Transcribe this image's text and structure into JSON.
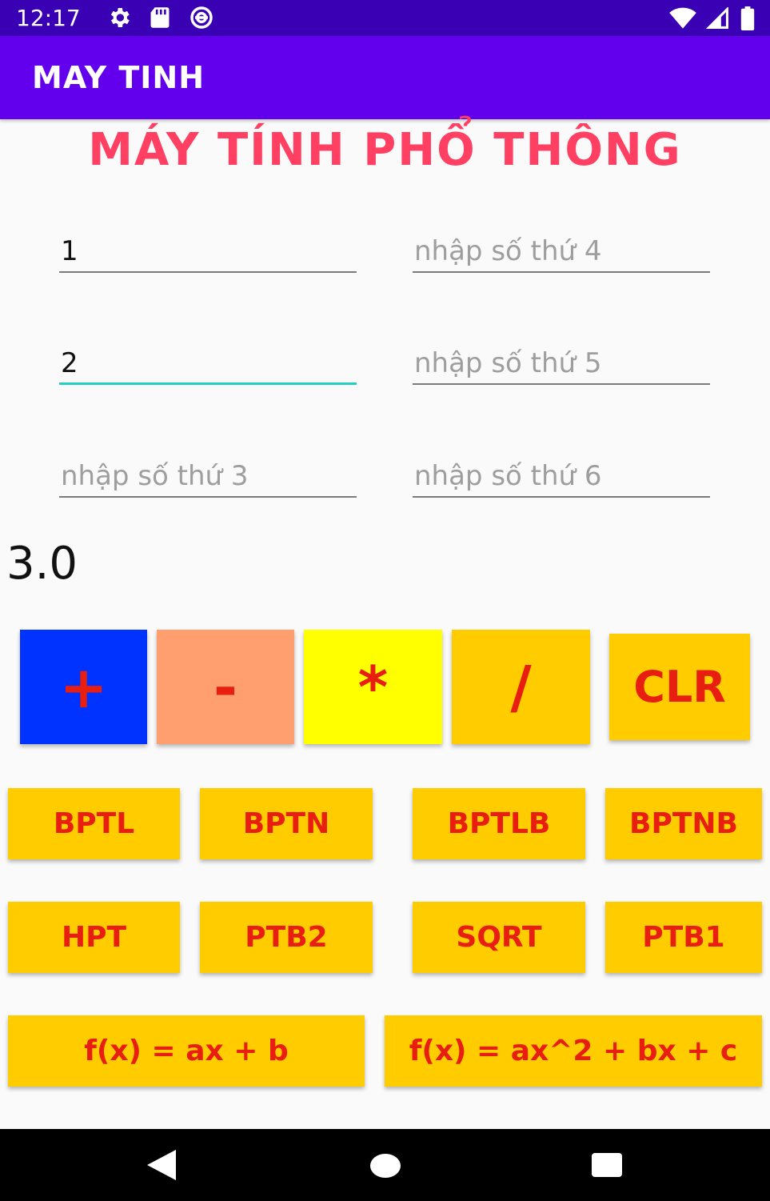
{
  "status_bar": {
    "time": "12:17"
  },
  "app_bar": {
    "title": "MAY TINH"
  },
  "heading": "MÁY TÍNH PHỔ THÔNG",
  "fields": [
    {
      "value": "1",
      "placeholder": ""
    },
    {
      "value": "2",
      "placeholder": ""
    },
    {
      "value": "",
      "placeholder": "nhập số thứ 3"
    },
    {
      "value": "",
      "placeholder": "nhập số thứ 4"
    },
    {
      "value": "",
      "placeholder": "nhập số thứ 5"
    },
    {
      "value": "",
      "placeholder": "nhập số thứ 6"
    }
  ],
  "result": "3.0",
  "operators": {
    "add": "+",
    "subtract": "-",
    "multiply": "*",
    "divide": "/",
    "clear": "CLR"
  },
  "functions": {
    "bptl": "BPTL",
    "bptn": "BPTN",
    "bptlb": "BPTLB",
    "bptnb": "BPTNB",
    "hpt": "HPT",
    "ptb2": "PTB2",
    "sqrt": "SQRT",
    "ptb1": "PTB1",
    "linear": "f(x) = ax + b",
    "quadratic": "f(x) = ax^2 + bx + c"
  },
  "colors": {
    "add_bg": "#0033ff",
    "subtract_bg": "#ff9e6e",
    "multiply_bg": "#ffff00",
    "divide_bg": "#ffcc00",
    "clear_bg": "#ffcc00",
    "button_text": "#e81e10",
    "app_bar": "#6200ee",
    "status_bar": "#3a00b4",
    "heading": "#ff4062",
    "focus": "#26d0c0"
  }
}
